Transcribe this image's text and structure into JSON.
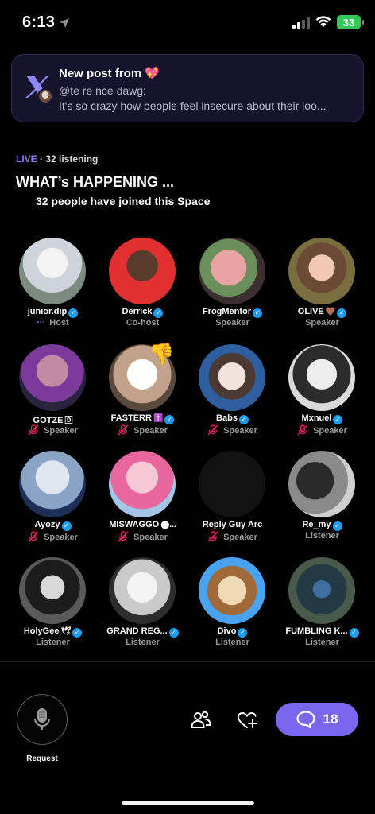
{
  "status_bar": {
    "time": "6:13",
    "battery": "33"
  },
  "banner": {
    "title": "New post from",
    "title_emoji": "💖",
    "handle": "@te re nce dawg:",
    "text": "It's so crazy how people feel insecure about their loo..."
  },
  "space": {
    "live_label": "LIVE",
    "listening": "· 32 listening",
    "title": "WHAT’s HAPPENING ...",
    "subtitle": "32 people have joined this Space"
  },
  "participants": [
    {
      "name": "junior.dip",
      "verified": true,
      "role": "Host",
      "badge": "",
      "muted": false,
      "host_dots": "···"
    },
    {
      "name": "Derrick",
      "verified": true,
      "role": "Co-host",
      "badge": "",
      "muted": false
    },
    {
      "name": "FrogMentor",
      "verified": true,
      "role": "Speaker",
      "badge": "",
      "muted": false
    },
    {
      "name": "OLIVE",
      "verified": true,
      "role": "Speaker",
      "badge": "🤎",
      "muted": false
    },
    {
      "name": "GOTZE",
      "verified": false,
      "role": "Speaker",
      "badge": "🄳",
      "muted": true
    },
    {
      "name": "FASTERR",
      "verified": true,
      "role": "Speaker",
      "badge": "✝️",
      "muted": true,
      "reaction": "👎"
    },
    {
      "name": "Babs",
      "verified": true,
      "role": "Speaker",
      "badge": "",
      "muted": true
    },
    {
      "name": "Mxnuel",
      "verified": true,
      "role": "Speaker",
      "badge": "",
      "muted": true
    },
    {
      "name": "Ayozy",
      "verified": true,
      "role": "Speaker",
      "badge": "",
      "muted": true
    },
    {
      "name": "MISWAGGO",
      "verified": false,
      "role": "Speaker",
      "badge": "⬤...",
      "muted": true
    },
    {
      "name": "Reply Guy Arc",
      "verified": false,
      "role": "Speaker",
      "badge": "",
      "muted": true
    },
    {
      "name": "Re_my",
      "verified": true,
      "role": "Listener",
      "badge": "",
      "muted": false
    },
    {
      "name": "HolyGee",
      "verified": true,
      "role": "Listener",
      "badge": "🕊",
      "muted": false
    },
    {
      "name": "GRAND REG...",
      "verified": true,
      "role": "Listener",
      "badge": "",
      "muted": false
    },
    {
      "name": "Divo",
      "verified": true,
      "role": "Listener",
      "badge": "",
      "muted": false
    },
    {
      "name": "FUMBLING K...",
      "verified": true,
      "role": "Listener",
      "badge": "",
      "muted": false
    }
  ],
  "bottom_bar": {
    "request_label": "Request",
    "comment_count": "18"
  },
  "colors": {
    "accent": "#7b66f0",
    "live": "#8b7cff",
    "verify": "#1d9bf0",
    "muted": "#e0245e"
  }
}
